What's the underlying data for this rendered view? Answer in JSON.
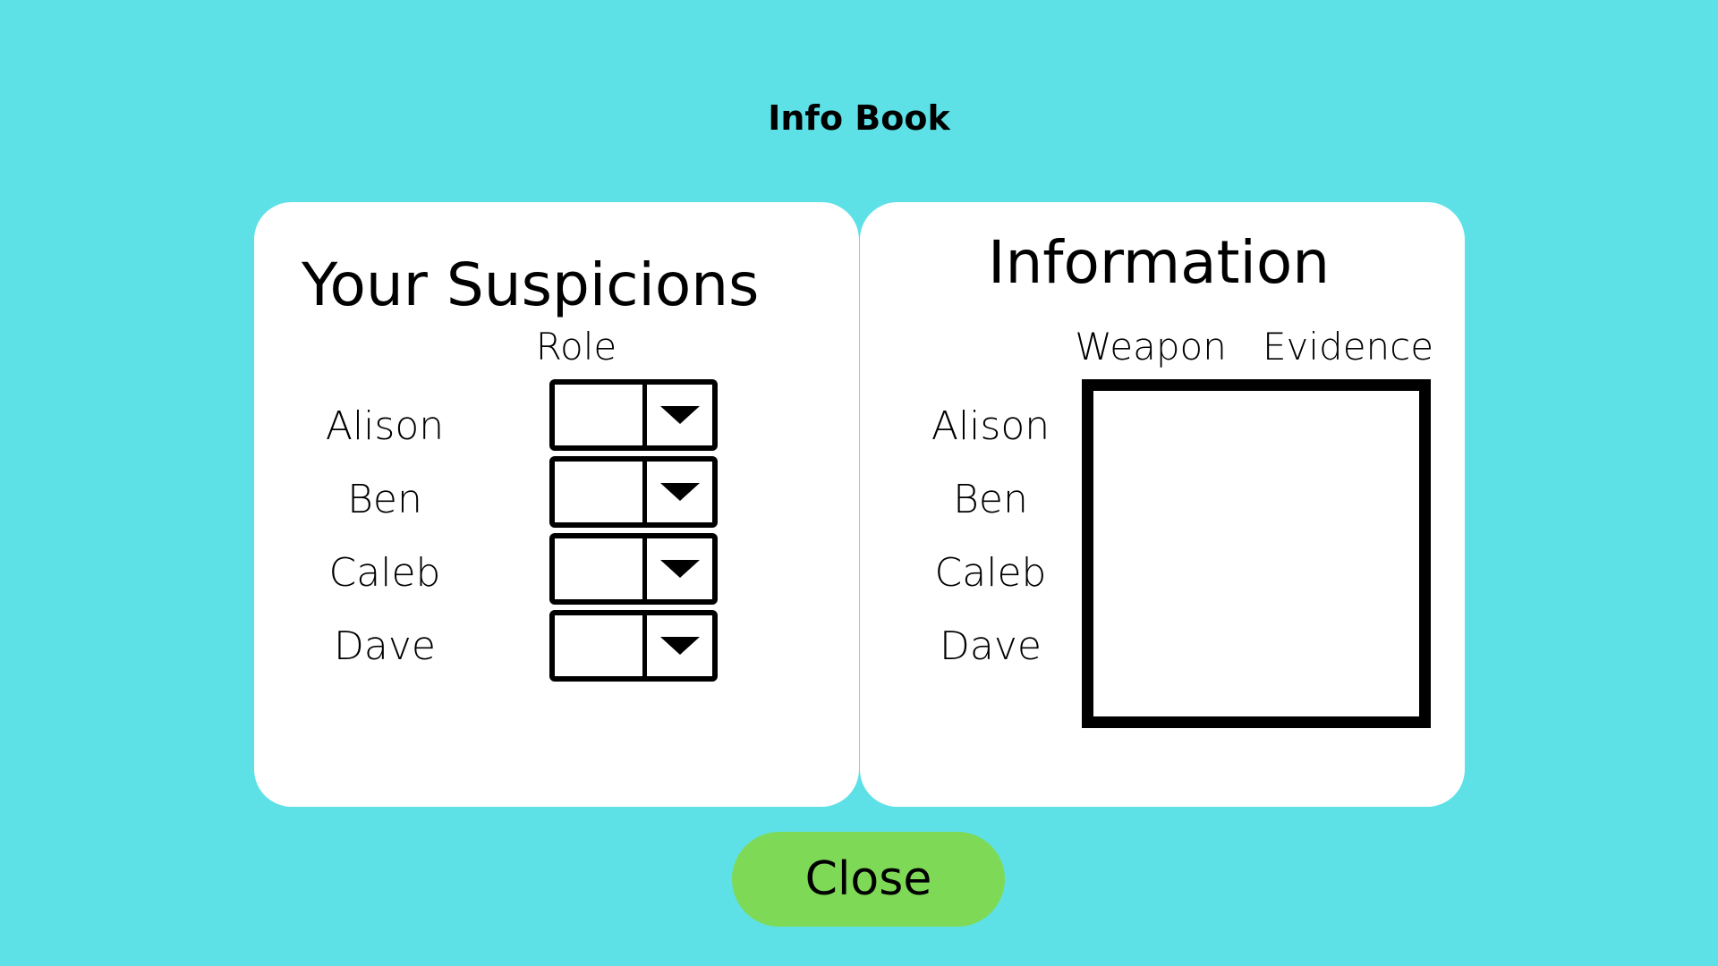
{
  "page": {
    "title": "Info Book",
    "background_color": "#5ee1e6"
  },
  "suspicions": {
    "title": "Your Suspicions",
    "column_header": "Role",
    "suspects": [
      {
        "name": "Alison",
        "role": ""
      },
      {
        "name": "Ben",
        "role": ""
      },
      {
        "name": "Caleb",
        "role": ""
      },
      {
        "name": "Dave",
        "role": ""
      }
    ],
    "dropdown_icon": "chevron-down-icon"
  },
  "information": {
    "title": "Information",
    "column_headers": [
      "Weapon",
      "Evidence"
    ],
    "suspects": [
      "Alison",
      "Ben",
      "Caleb",
      "Dave"
    ]
  },
  "close_button": {
    "label": "Close",
    "color": "#7ed957"
  }
}
